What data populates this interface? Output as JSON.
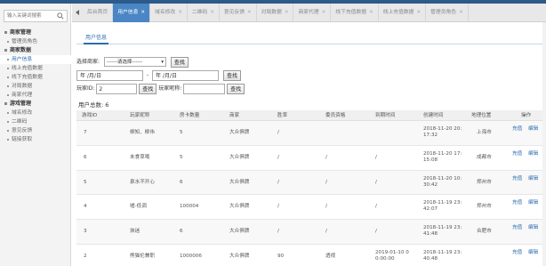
{
  "sidebar": {
    "search_placeholder": "输入关键词搜索",
    "groups": [
      {
        "label": "商家管理",
        "items": [
          {
            "label": "管理员角色",
            "active": false
          }
        ]
      },
      {
        "label": "商家数据",
        "items": [
          {
            "label": "用户信息",
            "active": true
          },
          {
            "label": "线上充值数据",
            "active": false
          },
          {
            "label": "线下充值数据",
            "active": false
          },
          {
            "label": "对局数据",
            "active": false
          },
          {
            "label": "商家代理",
            "active": false
          }
        ]
      },
      {
        "label": "游戏管理",
        "items": [
          {
            "label": "域名修改",
            "active": false
          },
          {
            "label": "二维码",
            "active": false
          },
          {
            "label": "意见反馈",
            "active": false
          },
          {
            "label": "链接获取",
            "active": false
          }
        ]
      }
    ]
  },
  "tabs": [
    {
      "label": "后台首页",
      "active": false,
      "closable": false
    },
    {
      "label": "用户信息",
      "active": true,
      "closable": true
    },
    {
      "label": "域名修改",
      "active": false,
      "closable": true
    },
    {
      "label": "二维码",
      "active": false,
      "closable": true
    },
    {
      "label": "意见反馈",
      "active": false,
      "closable": true
    },
    {
      "label": "对局数据",
      "active": false,
      "closable": true
    },
    {
      "label": "商家代理",
      "active": false,
      "closable": true
    },
    {
      "label": "线下充值数据",
      "active": false,
      "closable": true
    },
    {
      "label": "线上充值数据",
      "active": false,
      "closable": true
    },
    {
      "label": "管理员角色",
      "active": false,
      "closable": true
    }
  ],
  "subtab": "用户信息",
  "filters": {
    "merchant_label": "选择商家:",
    "merchant_value": "------请选择------",
    "query_label": "查找",
    "date_from": "年 /月/日",
    "date_sep": "-",
    "date_to": "年 /月/日",
    "player_id_label": "玩家ID:",
    "player_id_value": "2",
    "player_nick_label": "玩家昵称:",
    "player_nick_value": ""
  },
  "total_label": "用户总数: 6",
  "table": {
    "columns": [
      "游戏ID",
      "玩家昵称",
      "房卡数量",
      "商家",
      "胜率",
      "委员资格",
      "到期时间",
      "创建时间",
      "地理位置",
      "操作"
    ],
    "rows": [
      {
        "id": "7",
        "nick": "柳知、柳伟",
        "cards": "5",
        "merchant": "大众俱牌",
        "win": "/",
        "member": "",
        "expire": "",
        "created": [
          "2018-11-20 20:",
          "17:32"
        ],
        "location": "上海市"
      },
      {
        "id": "6",
        "nick": "未食草哦",
        "cards": "5",
        "merchant": "大众俱牌",
        "win": "/",
        "member": "/",
        "expire": "/",
        "created": [
          "2018-11-20 17:",
          "15:08"
        ],
        "location": "成都市"
      },
      {
        "id": "5",
        "nick": "泉水不开心",
        "cards": "6",
        "merchant": "大众俱牌",
        "win": "/",
        "member": "/",
        "expire": "/",
        "created": [
          "2018-11-20 10:",
          "30:42"
        ],
        "location": "郑州市"
      },
      {
        "id": "4",
        "nick": "嘘-低调",
        "cards": "100004",
        "merchant": "大众俱牌",
        "win": "/",
        "member": "/",
        "expire": "/",
        "created": [
          "2018-11-19 23:",
          "42:07"
        ],
        "location": "郑州市"
      },
      {
        "id": "3",
        "nick": "抹迷",
        "cards": "6",
        "merchant": "大众俱牌",
        "win": "/",
        "member": "/",
        "expire": "/",
        "created": [
          "2018-11-19 23:",
          "41:48"
        ],
        "location": "合肥市"
      },
      {
        "id": "2",
        "nick": "熊猫伦兼职",
        "cards": "1000006",
        "merchant": "大众俱牌",
        "win": "90",
        "member": "透视",
        "expire": "2019-01-10 0",
        "expire2": "0:00:00",
        "created": [
          "2018-11-19 23:",
          "40:48"
        ],
        "location": ""
      }
    ],
    "op_recharge": "充值",
    "op_edit": "编辑"
  },
  "colors": {
    "accent": "#4a86c5",
    "link": "#2b6cb0",
    "topbar": "#2c5a8a"
  }
}
